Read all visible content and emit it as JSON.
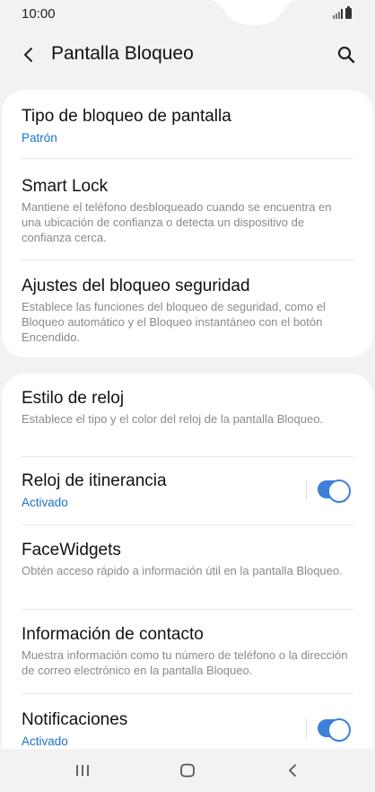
{
  "status_bar": {
    "time": "10:00"
  },
  "header": {
    "title": "Pantalla Bloqueo"
  },
  "section1": {
    "items": [
      {
        "title": "Tipo de bloqueo de pantalla",
        "value": "Patrón"
      },
      {
        "title": "Smart Lock",
        "subtitle": "Mantiene el teléfono desbloqueado cuando se encuentra en una ubicación de confianza o detecta un dispositivo de confianza cerca."
      },
      {
        "title": "Ajustes del bloqueo seguridad",
        "subtitle": "Establece las funciones del bloqueo de seguridad, como el Bloqueo automático y el Bloqueo instantáneo con el botón Encendido."
      }
    ]
  },
  "section2": {
    "items": [
      {
        "title": "Estilo de reloj",
        "subtitle": "Establece el tipo y el color del reloj de la pantalla Bloqueo."
      },
      {
        "title": "Reloj de itinerancia",
        "value": "Activado",
        "toggle_on": true
      },
      {
        "title": "FaceWidgets",
        "subtitle": "Obtén acceso rápido a información útil en la pantalla Bloqueo."
      },
      {
        "title": "Información de contacto",
        "subtitle": "Muestra información como tu número de teléfono o la dirección de correo electrónico en la pantalla Bloqueo."
      },
      {
        "title": "Notificaciones",
        "value": "Activado",
        "toggle_on": true
      }
    ]
  },
  "colors": {
    "accent": "#1a73c8",
    "toggle": "#3e7fd8",
    "background": "#f2f2f2"
  },
  "icons": {
    "back": "back-arrow-icon",
    "search": "search-icon",
    "recents": "recents-icon",
    "home": "home-icon",
    "nav_back": "nav-back-icon"
  }
}
